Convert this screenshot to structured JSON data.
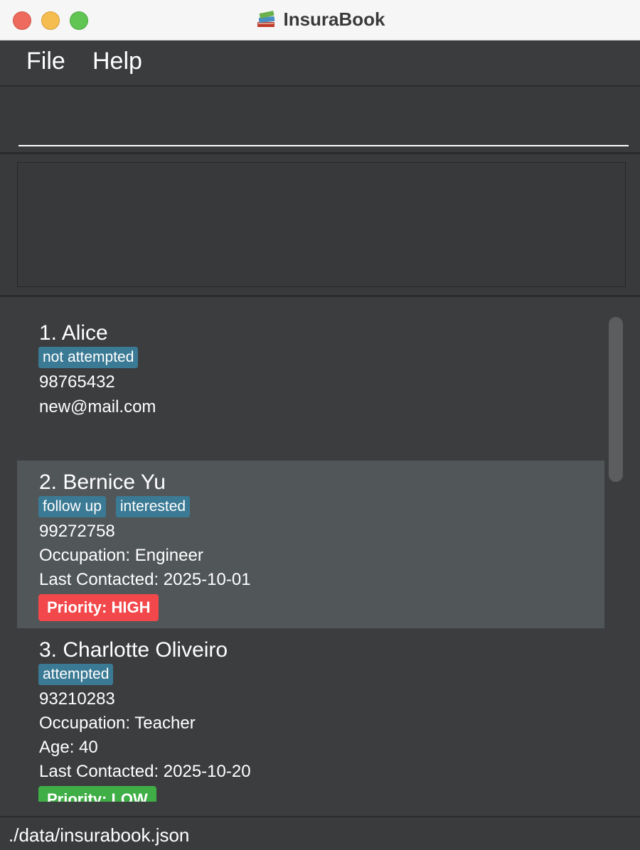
{
  "window": {
    "title": "InsuraBook",
    "icon": "books-icon"
  },
  "menu": {
    "items": [
      "File",
      "Help"
    ]
  },
  "command": {
    "value": "",
    "placeholder": ""
  },
  "result": {
    "text": ""
  },
  "persons": [
    {
      "name": "1. Alice",
      "tags": [
        "not attempted"
      ],
      "phone": "98765432",
      "email": "new@mail.com"
    },
    {
      "name": "2. Bernice Yu",
      "tags": [
        "follow up",
        "interested"
      ],
      "phone": "99272758",
      "occupation": "Occupation: Engineer",
      "last_contacted": "Last Contacted: 2025-10-01",
      "priority": "Priority: HIGH",
      "selected": true
    },
    {
      "name": "3. Charlotte Oliveiro",
      "tags": [
        "attempted"
      ],
      "phone": "93210283",
      "occupation": "Occupation: Teacher",
      "age": "Age: 40",
      "last_contacted": "Last Contacted: 2025-10-20",
      "priority": "Priority: LOW"
    }
  ],
  "colors": {
    "tag": "#3b7a94",
    "priority_high": "#f2484b",
    "priority_low": "#3fae46",
    "selected_row": "#515659"
  },
  "status": {
    "path": "./data/insurabook.json"
  }
}
